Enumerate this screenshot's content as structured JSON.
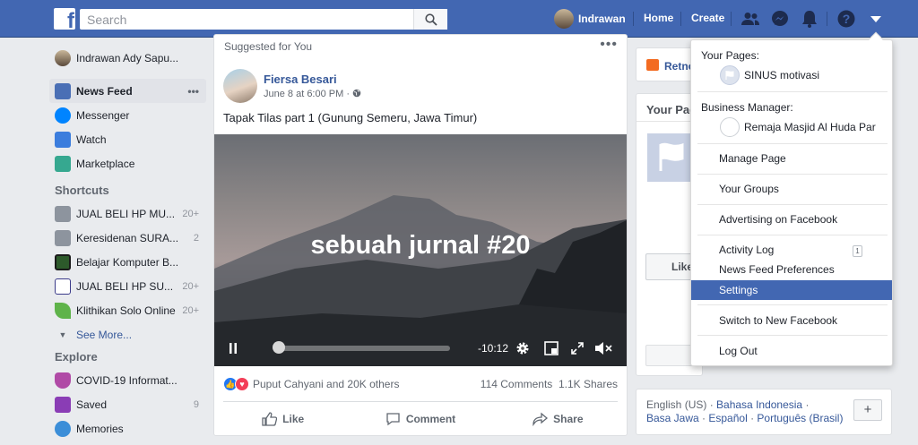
{
  "topbar": {
    "logo": "f",
    "search_placeholder": "Search",
    "user_name": "Indrawan",
    "home_label": "Home",
    "create_label": "Create",
    "icons": [
      "friends-icon",
      "messenger-icon",
      "notifications-icon",
      "help-icon",
      "account-menu-icon"
    ],
    "bar_color": "#4267b2"
  },
  "sidebar": {
    "user_name": "Indrawan Ady Sapu...",
    "main": [
      {
        "label": "News Feed",
        "icon": "news-feed-icon",
        "active": true
      },
      {
        "label": "Messenger",
        "icon": "messenger-icon"
      },
      {
        "label": "Watch",
        "icon": "watch-icon"
      },
      {
        "label": "Marketplace",
        "icon": "marketplace-icon"
      }
    ],
    "more_dots": "•••",
    "shortcuts_title": "Shortcuts",
    "shortcuts": [
      {
        "label": "JUAL BELI HP MU...",
        "count": "20+"
      },
      {
        "label": "Keresidenan SURA...",
        "count": "2"
      },
      {
        "label": "Belajar Komputer B...",
        "count": ""
      },
      {
        "label": "JUAL BELI HP SU...",
        "count": "20+"
      },
      {
        "label": "Klithikan Solo Online",
        "count": "20+"
      }
    ],
    "see_more": "See More...",
    "explore_title": "Explore",
    "explore": [
      {
        "label": "COVID-19 Informat...",
        "count": ""
      },
      {
        "label": "Saved",
        "count": "9"
      },
      {
        "label": "Memories",
        "count": ""
      }
    ]
  },
  "post": {
    "suggested": "Suggested for You",
    "author": "Fiersa Besari",
    "time": "June 8 at 6:00 PM · ",
    "text": "Tapak Tilas part 1 (Gunung Semeru, Jawa Timur)",
    "video_title": "sebuah jurnal #20",
    "video_time": "-10:12",
    "video_progress": 0.03,
    "reactions_text": "Puput Cahyani and 20K others",
    "comments": "114 Comments",
    "shares": "1.1K Shares",
    "like_label": "Like",
    "comment_label": "Comment",
    "share_label": "Share"
  },
  "right": {
    "retno": "Retno",
    "your_pages": "Your Pag",
    "like_btn": "Like",
    "languages": {
      "current": "English (US)",
      "sep": " · ",
      "l1": "Bahasa Indonesia",
      "l2": "Basa Jawa",
      "l3": "Español",
      "l4": "Português (Brasil)",
      "plus": "+"
    }
  },
  "dropdown": {
    "your_pages_title": "Your Pages:",
    "page_name": "SINUS motivasi",
    "bm_title": "Business Manager:",
    "bm_name": "Remaja Masjid Al Huda Par",
    "items": [
      {
        "label": "Manage Page"
      },
      {
        "label": "Your Groups"
      },
      {
        "label": "Advertising on Facebook"
      },
      {
        "label": "Activity Log",
        "badge": "1"
      },
      {
        "label": "News Feed Preferences"
      },
      {
        "label": "Settings",
        "selected": true
      },
      {
        "label": "Switch to New Facebook"
      },
      {
        "label": "Log Out"
      }
    ]
  }
}
